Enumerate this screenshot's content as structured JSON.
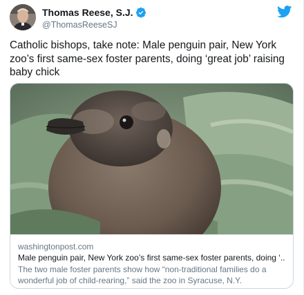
{
  "author": {
    "display_name": "Thomas Reese, S.J.",
    "handle": "@ThomasReeseSJ",
    "verified": true
  },
  "tweet": {
    "text": "Catholic bishops, take note: Male penguin pair, New York zoo’s first same-sex foster parents, doing ‘great job’ raising baby chick"
  },
  "card": {
    "domain": "washingtonpost.com",
    "title": "Male penguin pair, New York zoo’s first same-sex foster parents, doing ‘...",
    "description": "The two male foster parents show how “non-traditional families do a wonderful job of child-rearing,” said the zoo in Syracuse, N.Y.",
    "image_subject": "penguin chick on a green blanket"
  },
  "icons": {
    "verified": "verified-badge-icon",
    "brand": "twitter-bird-icon"
  },
  "colors": {
    "twitter_blue": "#1da1f2",
    "text_primary": "#14171a",
    "text_secondary": "#657786",
    "border": "#ccd6dd"
  }
}
